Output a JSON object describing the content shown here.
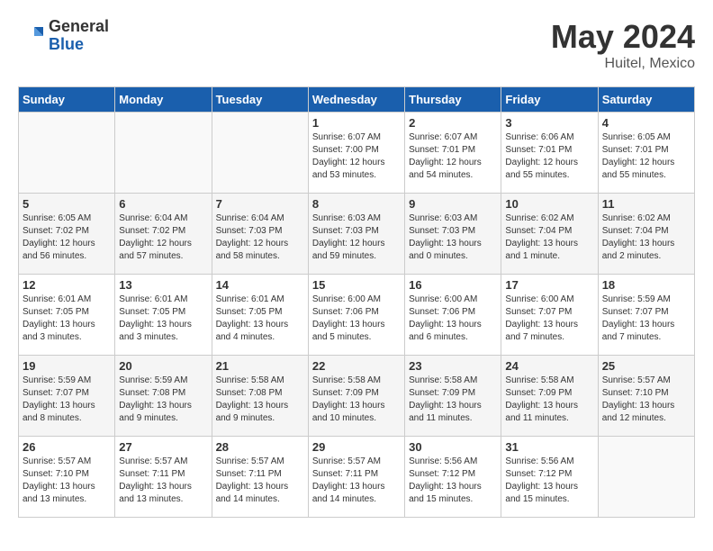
{
  "logo": {
    "general": "General",
    "blue": "Blue"
  },
  "header": {
    "month_year": "May 2024",
    "location": "Huitel, Mexico"
  },
  "weekdays": [
    "Sunday",
    "Monday",
    "Tuesday",
    "Wednesday",
    "Thursday",
    "Friday",
    "Saturday"
  ],
  "weeks": [
    [
      {
        "day": "",
        "info": ""
      },
      {
        "day": "",
        "info": ""
      },
      {
        "day": "",
        "info": ""
      },
      {
        "day": "1",
        "info": "Sunrise: 6:07 AM\nSunset: 7:00 PM\nDaylight: 12 hours\nand 53 minutes."
      },
      {
        "day": "2",
        "info": "Sunrise: 6:07 AM\nSunset: 7:01 PM\nDaylight: 12 hours\nand 54 minutes."
      },
      {
        "day": "3",
        "info": "Sunrise: 6:06 AM\nSunset: 7:01 PM\nDaylight: 12 hours\nand 55 minutes."
      },
      {
        "day": "4",
        "info": "Sunrise: 6:05 AM\nSunset: 7:01 PM\nDaylight: 12 hours\nand 55 minutes."
      }
    ],
    [
      {
        "day": "5",
        "info": "Sunrise: 6:05 AM\nSunset: 7:02 PM\nDaylight: 12 hours\nand 56 minutes."
      },
      {
        "day": "6",
        "info": "Sunrise: 6:04 AM\nSunset: 7:02 PM\nDaylight: 12 hours\nand 57 minutes."
      },
      {
        "day": "7",
        "info": "Sunrise: 6:04 AM\nSunset: 7:03 PM\nDaylight: 12 hours\nand 58 minutes."
      },
      {
        "day": "8",
        "info": "Sunrise: 6:03 AM\nSunset: 7:03 PM\nDaylight: 12 hours\nand 59 minutes."
      },
      {
        "day": "9",
        "info": "Sunrise: 6:03 AM\nSunset: 7:03 PM\nDaylight: 13 hours\nand 0 minutes."
      },
      {
        "day": "10",
        "info": "Sunrise: 6:02 AM\nSunset: 7:04 PM\nDaylight: 13 hours\nand 1 minute."
      },
      {
        "day": "11",
        "info": "Sunrise: 6:02 AM\nSunset: 7:04 PM\nDaylight: 13 hours\nand 2 minutes."
      }
    ],
    [
      {
        "day": "12",
        "info": "Sunrise: 6:01 AM\nSunset: 7:05 PM\nDaylight: 13 hours\nand 3 minutes."
      },
      {
        "day": "13",
        "info": "Sunrise: 6:01 AM\nSunset: 7:05 PM\nDaylight: 13 hours\nand 3 minutes."
      },
      {
        "day": "14",
        "info": "Sunrise: 6:01 AM\nSunset: 7:05 PM\nDaylight: 13 hours\nand 4 minutes."
      },
      {
        "day": "15",
        "info": "Sunrise: 6:00 AM\nSunset: 7:06 PM\nDaylight: 13 hours\nand 5 minutes."
      },
      {
        "day": "16",
        "info": "Sunrise: 6:00 AM\nSunset: 7:06 PM\nDaylight: 13 hours\nand 6 minutes."
      },
      {
        "day": "17",
        "info": "Sunrise: 6:00 AM\nSunset: 7:07 PM\nDaylight: 13 hours\nand 7 minutes."
      },
      {
        "day": "18",
        "info": "Sunrise: 5:59 AM\nSunset: 7:07 PM\nDaylight: 13 hours\nand 7 minutes."
      }
    ],
    [
      {
        "day": "19",
        "info": "Sunrise: 5:59 AM\nSunset: 7:07 PM\nDaylight: 13 hours\nand 8 minutes."
      },
      {
        "day": "20",
        "info": "Sunrise: 5:59 AM\nSunset: 7:08 PM\nDaylight: 13 hours\nand 9 minutes."
      },
      {
        "day": "21",
        "info": "Sunrise: 5:58 AM\nSunset: 7:08 PM\nDaylight: 13 hours\nand 9 minutes."
      },
      {
        "day": "22",
        "info": "Sunrise: 5:58 AM\nSunset: 7:09 PM\nDaylight: 13 hours\nand 10 minutes."
      },
      {
        "day": "23",
        "info": "Sunrise: 5:58 AM\nSunset: 7:09 PM\nDaylight: 13 hours\nand 11 minutes."
      },
      {
        "day": "24",
        "info": "Sunrise: 5:58 AM\nSunset: 7:09 PM\nDaylight: 13 hours\nand 11 minutes."
      },
      {
        "day": "25",
        "info": "Sunrise: 5:57 AM\nSunset: 7:10 PM\nDaylight: 13 hours\nand 12 minutes."
      }
    ],
    [
      {
        "day": "26",
        "info": "Sunrise: 5:57 AM\nSunset: 7:10 PM\nDaylight: 13 hours\nand 13 minutes."
      },
      {
        "day": "27",
        "info": "Sunrise: 5:57 AM\nSunset: 7:11 PM\nDaylight: 13 hours\nand 13 minutes."
      },
      {
        "day": "28",
        "info": "Sunrise: 5:57 AM\nSunset: 7:11 PM\nDaylight: 13 hours\nand 14 minutes."
      },
      {
        "day": "29",
        "info": "Sunrise: 5:57 AM\nSunset: 7:11 PM\nDaylight: 13 hours\nand 14 minutes."
      },
      {
        "day": "30",
        "info": "Sunrise: 5:56 AM\nSunset: 7:12 PM\nDaylight: 13 hours\nand 15 minutes."
      },
      {
        "day": "31",
        "info": "Sunrise: 5:56 AM\nSunset: 7:12 PM\nDaylight: 13 hours\nand 15 minutes."
      },
      {
        "day": "",
        "info": ""
      }
    ]
  ]
}
